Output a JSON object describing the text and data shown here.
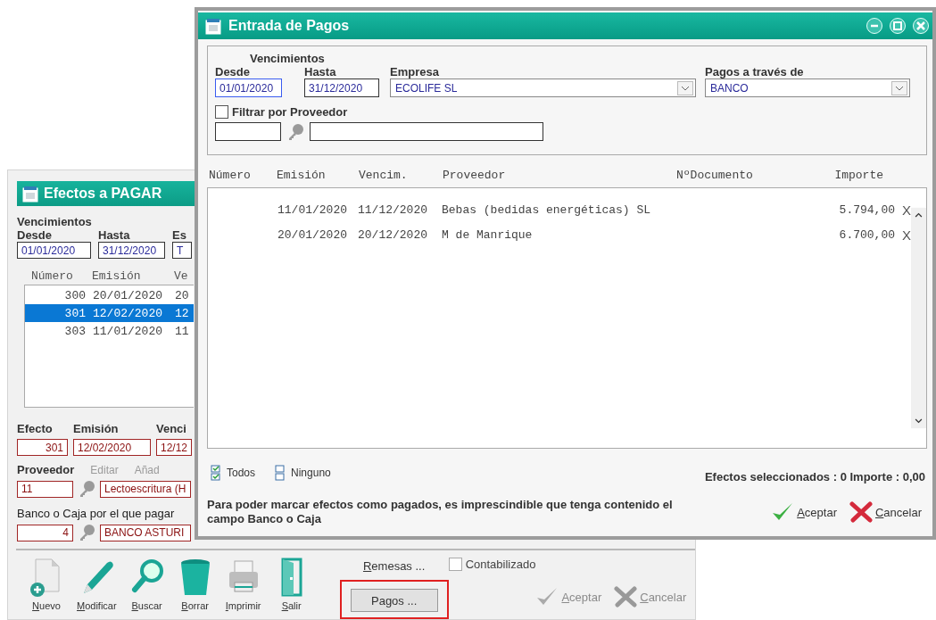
{
  "back_window": {
    "title": "Efectos a PAGAR",
    "vencimientos_label": "Vencimientos",
    "labels": [
      "Desde",
      "Hasta",
      "Es"
    ],
    "fields": [
      "01/01/2020",
      "31/12/2020",
      "T"
    ],
    "list": {
      "columns": [
        "Número",
        "Emisión",
        "Ve"
      ],
      "rows": [
        {
          "cells": [
            "300",
            "20/01/2020",
            "20"
          ],
          "selected": false
        },
        {
          "cells": [
            "301",
            "12/02/2020",
            "12"
          ],
          "selected": true
        },
        {
          "cells": [
            "303",
            "11/01/2020",
            "11"
          ],
          "selected": false
        }
      ]
    },
    "efecto_labels": [
      "Efecto",
      "Emisión",
      "Venci"
    ],
    "efecto_fields": [
      "301",
      "12/02/2020",
      "12/12"
    ],
    "proveedor_label": "Proveedor",
    "proveedor_links": [
      {
        "label": "Editar",
        "disabled": true
      },
      {
        "label": "Añad",
        "disabled": true
      }
    ],
    "proveedor_code": "11",
    "proveedor_name": "Lectoescritura (H",
    "banco_label": "Banco o Caja por el que pagar",
    "banco_code": "4",
    "banco_name": "BANCO ASTURI",
    "toolbar": [
      {
        "kind": "new",
        "label": "Nuevo"
      },
      {
        "kind": "edit",
        "label": "Modificar"
      },
      {
        "kind": "search",
        "label": "Buscar"
      },
      {
        "kind": "delete",
        "label": "Borrar"
      },
      {
        "kind": "print",
        "label": "Imprimir"
      },
      {
        "kind": "exit",
        "label": "Salir"
      }
    ],
    "remesas": "Remesas ...",
    "contabilizado": {
      "label": "Contabilizado",
      "checked": false
    },
    "pagos_button": {
      "label": "Pagos ...",
      "highlighted": true
    },
    "actions": [
      {
        "kind": "accept",
        "label": "Aceptar",
        "disabled": true
      },
      {
        "kind": "cancel",
        "label": "Cancelar",
        "disabled": true
      }
    ]
  },
  "dialog": {
    "title": "Entrada de Pagos",
    "filters": {
      "vencimientos_label": "Vencimientos",
      "desde_label": "Desde",
      "hasta_label": "Hasta",
      "empresa_label": "Empresa",
      "pagos_label": "Pagos a través de",
      "desde": "01/01/2020",
      "hasta": "31/12/2020",
      "empresa": "ECOLIFE SL",
      "pagos": "BANCO",
      "filtrar": {
        "label": "Filtrar por Proveedor",
        "checked": false
      }
    },
    "table": {
      "columns": [
        "Número",
        "Emisión",
        "Vencim.",
        "Proveedor",
        "NºDocumento",
        "Importe"
      ],
      "rows": [
        {
          "emision": "11/01/2020",
          "vencim": "11/12/2020",
          "proveedor": "Bebas (bedidas energéticas) SL",
          "importe": "5.794,00",
          "mark": "X"
        },
        {
          "emision": "20/01/2020",
          "vencim": "20/12/2020",
          "proveedor": "M de Manrique",
          "importe": "6.700,00",
          "mark": "X"
        }
      ]
    },
    "todos": "Todos",
    "ninguno": "Ninguno",
    "summary": "Efectos seleccionados : 0 Importe : 0,00",
    "message": "Para poder marcar efectos como pagados, es imprescindible que tenga contenido el campo Banco o Caja",
    "actions": [
      {
        "kind": "accept",
        "label": "Aceptar",
        "disabled": false
      },
      {
        "kind": "cancel",
        "label": "Cancelar",
        "disabled": false
      }
    ]
  }
}
